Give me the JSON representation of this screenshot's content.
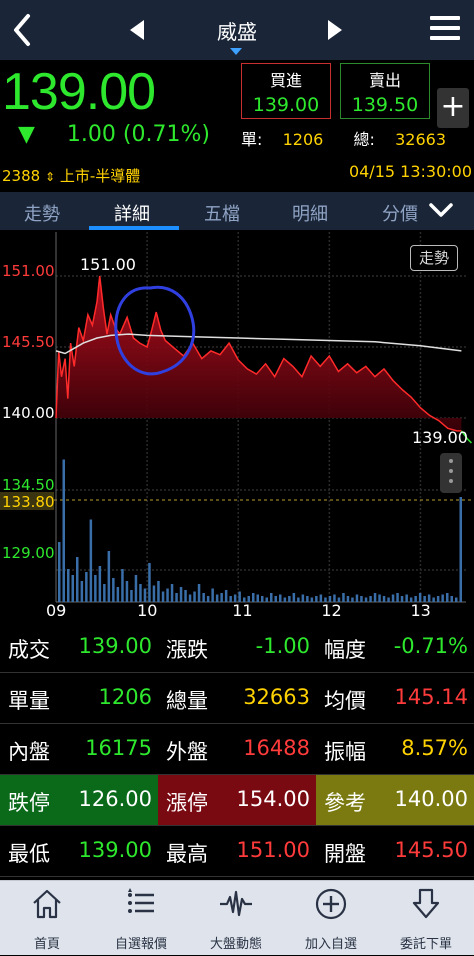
{
  "header": {
    "title": "威盛",
    "back_icon": "back-arrow-icon",
    "prev_icon": "triangle-left-icon",
    "next_icon": "triangle-right-icon",
    "menu_icon": "hamburger-menu-icon"
  },
  "quote": {
    "price": "139.00",
    "arrow": "▼",
    "change": "1.00",
    "change_pct": "(0.71%)",
    "bid_label": "買進",
    "bid_price": "139.00",
    "ask_label": "賣出",
    "ask_price": "139.50",
    "add_button": "+",
    "unit_label": "單:",
    "unit_volume": "1206",
    "total_label": "總:",
    "total_volume": "32663",
    "code": "2388",
    "market": "上市-半導體",
    "datetime": "04/15 13:30:00"
  },
  "tabs": [
    {
      "label": "走勢"
    },
    {
      "label": "詳細"
    },
    {
      "label": "五檔"
    },
    {
      "label": "明細"
    },
    {
      "label": "分價"
    }
  ],
  "active_tab": "詳細",
  "chart_data": {
    "type": "area",
    "trend_button": "走勢",
    "y_tick_labels": [
      "151.00",
      "145.50",
      "140.00",
      "134.50",
      "133.80",
      "129.00"
    ],
    "x_tick_labels": [
      "09",
      "10",
      "11",
      "12",
      "13"
    ],
    "high_annotation": "151.00",
    "last_annotation": "139.00",
    "reference_price": 140.0,
    "ylim": [
      133.8,
      151.0
    ],
    "price_series": [
      [
        9.0,
        140.0
      ],
      [
        9.03,
        145.2
      ],
      [
        9.06,
        143.2
      ],
      [
        9.1,
        144.6
      ],
      [
        9.13,
        141.5
      ],
      [
        9.16,
        145.8
      ],
      [
        9.2,
        144.0
      ],
      [
        9.25,
        147.0
      ],
      [
        9.3,
        146.0
      ],
      [
        9.35,
        148.0
      ],
      [
        9.4,
        147.2
      ],
      [
        9.45,
        149.0
      ],
      [
        9.48,
        151.0
      ],
      [
        9.52,
        148.5
      ],
      [
        9.56,
        146.5
      ],
      [
        9.6,
        148.0
      ],
      [
        9.65,
        147.0
      ],
      [
        9.7,
        146.5
      ],
      [
        9.78,
        147.8
      ],
      [
        9.85,
        146.2
      ],
      [
        9.92,
        145.8
      ],
      [
        10.0,
        145.5
      ],
      [
        10.05,
        146.8
      ],
      [
        10.1,
        148.2
      ],
      [
        10.15,
        146.8
      ],
      [
        10.2,
        146.0
      ],
      [
        10.3,
        145.4
      ],
      [
        10.4,
        144.8
      ],
      [
        10.5,
        145.8
      ],
      [
        10.6,
        144.6
      ],
      [
        10.7,
        145.2
      ],
      [
        10.8,
        144.9
      ],
      [
        10.9,
        145.8
      ],
      [
        11.0,
        144.5
      ],
      [
        11.1,
        143.8
      ],
      [
        11.2,
        143.4
      ],
      [
        11.3,
        144.2
      ],
      [
        11.4,
        143.2
      ],
      [
        11.5,
        144.6
      ],
      [
        11.6,
        144.0
      ],
      [
        11.7,
        143.2
      ],
      [
        11.8,
        144.8
      ],
      [
        11.9,
        144.0
      ],
      [
        12.0,
        144.8
      ],
      [
        12.1,
        143.6
      ],
      [
        12.2,
        144.2
      ],
      [
        12.3,
        143.5
      ],
      [
        12.4,
        144.0
      ],
      [
        12.5,
        143.2
      ],
      [
        12.6,
        143.8
      ],
      [
        12.7,
        142.9
      ],
      [
        12.8,
        142.2
      ],
      [
        12.9,
        141.6
      ],
      [
        13.0,
        140.8
      ],
      [
        13.1,
        140.2
      ],
      [
        13.2,
        139.8
      ],
      [
        13.3,
        139.2
      ],
      [
        13.4,
        139.0
      ],
      [
        13.45,
        139.0
      ]
    ],
    "avg_series": [
      [
        9.0,
        145.2
      ],
      [
        9.1,
        145.0
      ],
      [
        9.2,
        145.4
      ],
      [
        9.3,
        145.8
      ],
      [
        9.45,
        146.2
      ],
      [
        9.6,
        146.4
      ],
      [
        9.8,
        146.5
      ],
      [
        10.0,
        146.4
      ],
      [
        10.5,
        146.3
      ],
      [
        11.0,
        146.2
      ],
      [
        11.5,
        146.1
      ],
      [
        12.0,
        146.0
      ],
      [
        12.5,
        145.9
      ],
      [
        13.0,
        145.6
      ],
      [
        13.45,
        145.2
      ]
    ],
    "volume_scale_max": 100,
    "volume_pattern": [
      40,
      95,
      22,
      18,
      30,
      14,
      20,
      55,
      18,
      24,
      12,
      34,
      16,
      10,
      22,
      14,
      8,
      18,
      12,
      9,
      26,
      11,
      14,
      7,
      9,
      12,
      6,
      10,
      8,
      5,
      7,
      12,
      6,
      4,
      9,
      5,
      6,
      8,
      4,
      5,
      7,
      3,
      4,
      6,
      5,
      4,
      3,
      6,
      4,
      5,
      3,
      4,
      6,
      3,
      5,
      4,
      3,
      4,
      5,
      3,
      4,
      5,
      3,
      6,
      4,
      3,
      5,
      4,
      3,
      4,
      6,
      5,
      4,
      3,
      5,
      6,
      4,
      5,
      3,
      4,
      6,
      4,
      5,
      3,
      4,
      5,
      6,
      4,
      3,
      70
    ]
  },
  "stats": {
    "r1": [
      {
        "label": "成交",
        "value": "139.00",
        "color": "#2ee82e"
      },
      {
        "label": "漲跌",
        "value": "-1.00",
        "color": "#2ee82e"
      },
      {
        "label": "幅度",
        "value": "-0.71%",
        "color": "#2ee82e"
      }
    ],
    "r2": [
      {
        "label": "單量",
        "value": "1206",
        "color": "#2ee82e"
      },
      {
        "label": "總量",
        "value": "32663",
        "color": "#ffd200"
      },
      {
        "label": "均價",
        "value": "145.14",
        "color": "#ff3b3b"
      }
    ],
    "r3": [
      {
        "label": "內盤",
        "value": "16175",
        "color": "#2ee82e"
      },
      {
        "label": "外盤",
        "value": "16488",
        "color": "#ff3b3b"
      },
      {
        "label": "振幅",
        "value": "8.57%",
        "color": "#ffd200"
      }
    ],
    "r4": [
      {
        "label": "跌停",
        "value": "126.00",
        "color": "#ffffff",
        "bg": "#0a6a1a"
      },
      {
        "label": "漲停",
        "value": "154.00",
        "color": "#ffffff",
        "bg": "#7a0a12"
      },
      {
        "label": "參考",
        "value": "140.00",
        "color": "#ffffff",
        "bg": "#7a7a10"
      }
    ],
    "r5": [
      {
        "label": "最低",
        "value": "139.00",
        "color": "#2ee82e"
      },
      {
        "label": "最高",
        "value": "151.00",
        "color": "#ff3b3b"
      },
      {
        "label": "開盤",
        "value": "145.50",
        "color": "#ff3b3b"
      }
    ]
  },
  "bottom_nav": [
    {
      "label": "首頁",
      "icon": "home-icon"
    },
    {
      "label": "自選報價",
      "icon": "list-icon"
    },
    {
      "label": "大盤動態",
      "icon": "pulse-icon"
    },
    {
      "label": "加入自選",
      "icon": "add-circle-icon"
    },
    {
      "label": "委託下單",
      "icon": "order-icon"
    }
  ],
  "colors": {
    "up": "#ff3b3b",
    "down": "#2ee82e",
    "flat": "#ffd200",
    "bar": "#1a2638",
    "accent": "#1e8fff"
  }
}
